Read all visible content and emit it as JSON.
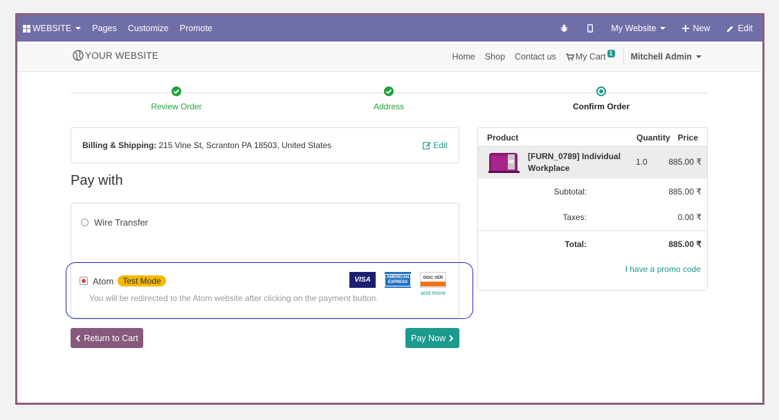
{
  "topbar": {
    "website_label": "WEBSITE",
    "pages": "Pages",
    "customize": "Customize",
    "promote": "Promote",
    "my_website": "My Website",
    "new": "New",
    "edit": "Edit"
  },
  "header": {
    "logo_text": "YOUR WEBSITE",
    "nav": [
      "Home",
      "Shop",
      "Contact us"
    ],
    "cart_label": "My Cart",
    "cart_count": "1",
    "user": "Mitchell Admin"
  },
  "steps": [
    {
      "label": "Review Order",
      "state": "done"
    },
    {
      "label": "Address",
      "state": "done"
    },
    {
      "label": "Confirm Order",
      "state": "current"
    }
  ],
  "billing": {
    "label": "Billing & Shipping:",
    "address": "215 Vine St, Scranton PA 18503, United States",
    "edit": "Edit"
  },
  "pay_with": "Pay with",
  "payment": {
    "wire": "Wire Transfer",
    "atom": "Atom",
    "test_mode": "Test Mode",
    "atom_desc": "You will be redirected to the Atom website after clicking on the payment button.",
    "cards": {
      "visa": "VISA",
      "amex_line1": "AMERICAN",
      "amex_line2": "EXPRESS",
      "discover": "DISC VER"
    },
    "and_more": "and more"
  },
  "buttons": {
    "return": "Return to Cart",
    "pay": "Pay Now"
  },
  "summary": {
    "headers": {
      "product": "Product",
      "quantity": "Quantity",
      "price": "Price"
    },
    "product_name": "[FURN_0789] Individual Workplace",
    "qty": "1.0",
    "price": "885.00 ₹",
    "subtotal_label": "Subtotal:",
    "subtotal": "885.00 ₹",
    "taxes_label": "Taxes:",
    "taxes": "0.00 ₹",
    "total_label": "Total:",
    "total": "885.00 ₹",
    "promo": "I have a promo code"
  },
  "colors": {
    "admin_bar": "#6f6ea6",
    "primary": "#875a7b",
    "accent": "#1c9a8e",
    "success": "#21a13a",
    "test_badge": "#f6b800",
    "highlight": "#2020c0"
  },
  "icons": [
    "apps-grid-icon",
    "bug-icon",
    "mobile-icon",
    "plus-icon",
    "pencil-icon",
    "globe-icon",
    "cart-icon",
    "check-icon",
    "edit-icon",
    "chevron-left-icon",
    "chevron-right-icon"
  ]
}
